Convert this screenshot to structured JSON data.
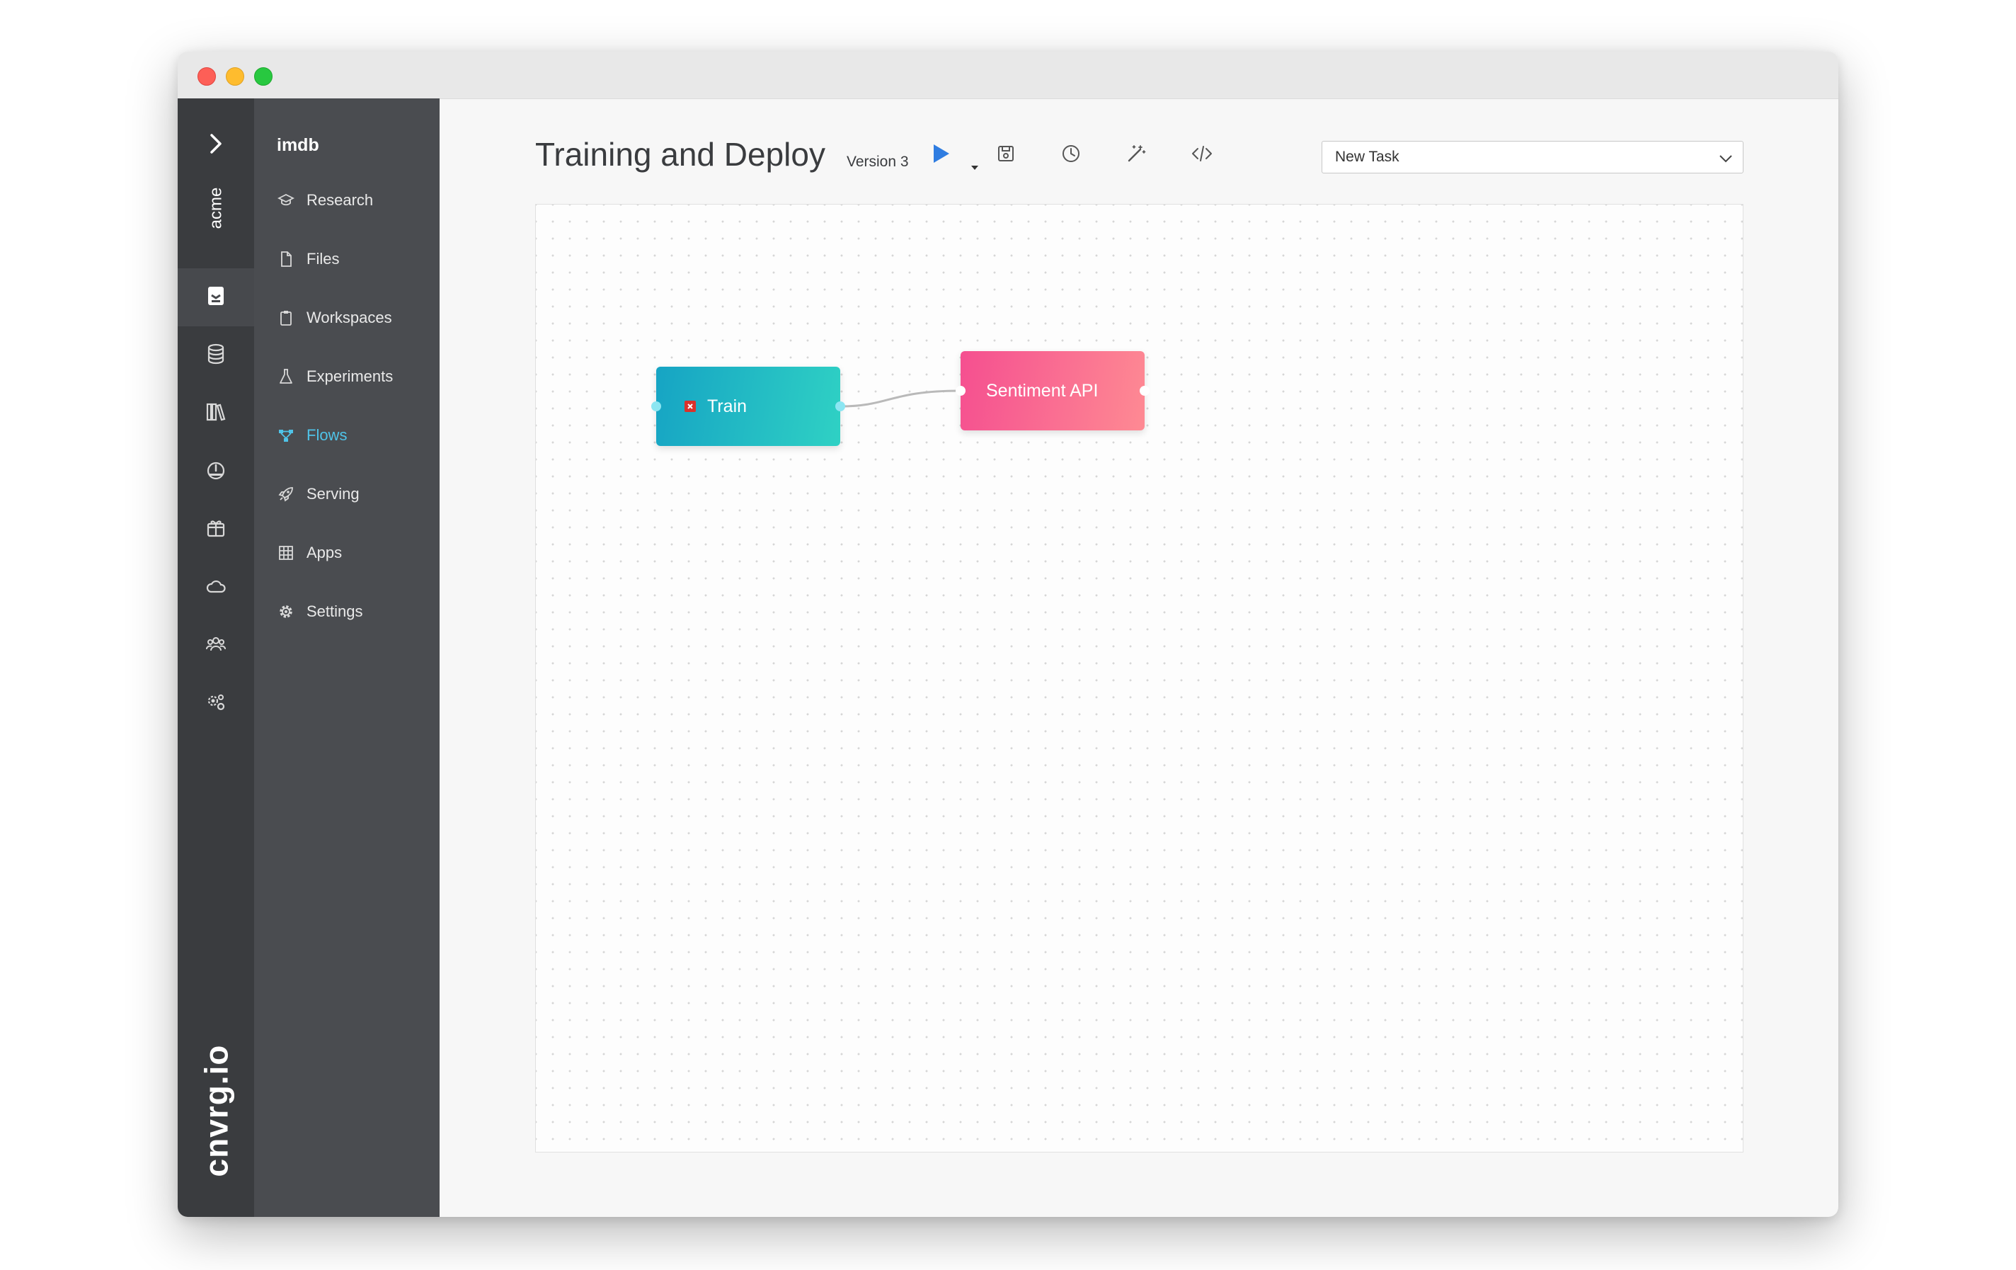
{
  "window": {
    "controls": [
      "close",
      "minimize",
      "zoom"
    ]
  },
  "rail": {
    "org": "acme",
    "logo": "cnvrg.io",
    "items": [
      {
        "icon": "project-icon",
        "active": true
      },
      {
        "icon": "database-icon",
        "active": false
      },
      {
        "icon": "library-icon",
        "active": false
      },
      {
        "icon": "dashboard-icon",
        "active": false
      },
      {
        "icon": "package-icon",
        "active": false
      },
      {
        "icon": "cloud-icon",
        "active": false
      },
      {
        "icon": "team-icon",
        "active": false
      },
      {
        "icon": "org-settings-icon",
        "active": false
      }
    ]
  },
  "sidebar": {
    "project": "imdb",
    "items": [
      {
        "label": "Research",
        "icon": "research-icon",
        "active": false
      },
      {
        "label": "Files",
        "icon": "file-icon",
        "active": false
      },
      {
        "label": "Workspaces",
        "icon": "clipboard-icon",
        "active": false
      },
      {
        "label": "Experiments",
        "icon": "flask-icon",
        "active": false
      },
      {
        "label": "Flows",
        "icon": "flow-icon",
        "active": true
      },
      {
        "label": "Serving",
        "icon": "rocket-icon",
        "active": false
      },
      {
        "label": "Apps",
        "icon": "grid-icon",
        "active": false
      },
      {
        "label": "Settings",
        "icon": "gear-icon",
        "active": false
      }
    ]
  },
  "header": {
    "title": "Training and Deploy",
    "version": "Version 3",
    "toolbar": [
      "play-icon",
      "save-icon",
      "history-icon",
      "magic-wand-icon",
      "code-icon"
    ],
    "task_select": "New Task"
  },
  "flow": {
    "nodes": [
      {
        "id": "train",
        "label": "Train",
        "status": "error"
      },
      {
        "id": "api",
        "label": "Sentiment API"
      }
    ],
    "edges": [
      {
        "from": "train",
        "to": "api"
      }
    ]
  },
  "colors": {
    "accent": "#4fc3e8",
    "play": "#2f7de1",
    "train_node": [
      "#16a4c4",
      "#2fd1c4"
    ],
    "api_node": [
      "#f54f90",
      "#fe8a93"
    ]
  }
}
